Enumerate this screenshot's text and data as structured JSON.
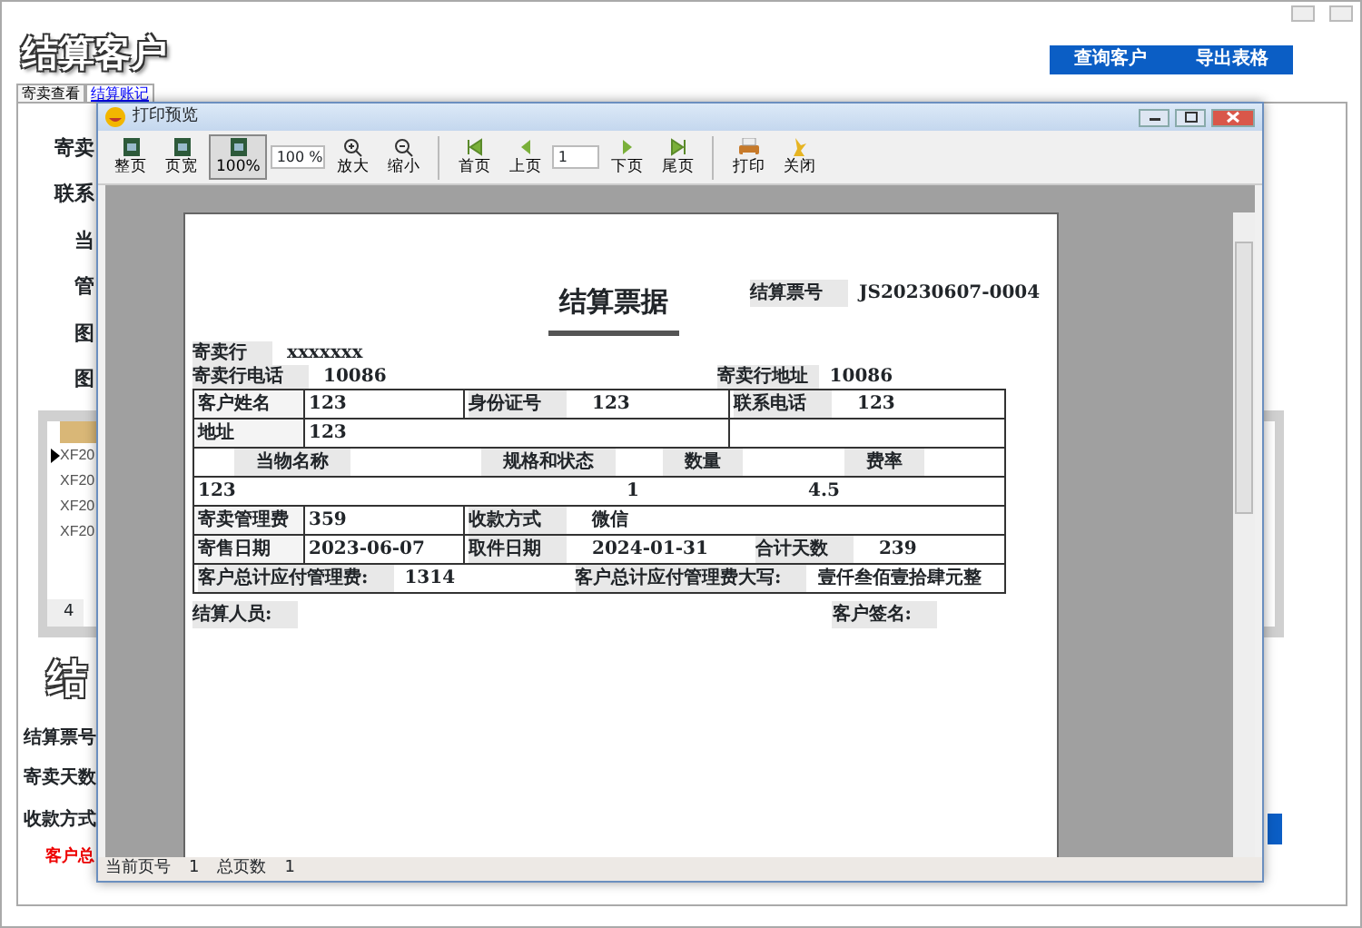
{
  "window": {
    "title": "结算客户",
    "buttons": [
      "查询客户",
      "导出表格"
    ]
  },
  "tabs": [
    {
      "label": "寄卖查看",
      "selected": false
    },
    {
      "label": "结算账记",
      "selected": true
    }
  ],
  "form_labels": [
    "寄卖",
    "联系",
    "当",
    "管",
    "图",
    "图"
  ],
  "grid": {
    "rows": [
      {
        "text": "XF20",
        "selected": true
      },
      {
        "text": "XF20",
        "selected": false
      },
      {
        "text": "XF20",
        "selected": false
      },
      {
        "text": "XF20",
        "selected": false
      }
    ],
    "footer": "4"
  },
  "summary": {
    "title": "结",
    "labels": [
      "结算票号",
      "寄卖天数",
      "收款方式"
    ],
    "total_label": "客户总"
  },
  "dialog": {
    "title": "打印预览",
    "toolbar": [
      {
        "kind": "page",
        "label": "整页",
        "selected": false
      },
      {
        "kind": "page",
        "label": "页宽",
        "selected": false
      },
      {
        "kind": "page",
        "label": "100%",
        "selected": true
      },
      {
        "kind": "field",
        "value": "100 %"
      },
      {
        "kind": "zoomin",
        "label": "放大",
        "selected": false
      },
      {
        "kind": "zoomout",
        "label": "缩小",
        "selected": false
      },
      {
        "kind": "separator"
      },
      {
        "kind": "first",
        "label": "首页",
        "selected": false
      },
      {
        "kind": "prev",
        "label": "上页",
        "selected": false
      },
      {
        "kind": "field",
        "value": "1"
      },
      {
        "kind": "next",
        "label": "下页",
        "selected": false
      },
      {
        "kind": "last",
        "label": "尾页",
        "selected": false
      },
      {
        "kind": "separator"
      },
      {
        "kind": "print",
        "label": "打印",
        "selected": false
      },
      {
        "kind": "exit",
        "label": "关闭",
        "selected": false
      }
    ],
    "status": [
      {
        "label": "当前页号",
        "value": "1"
      },
      {
        "label": "总页数",
        "value": "1"
      }
    ]
  },
  "report": {
    "title": "结算票据",
    "ticket_label": "结算票号",
    "ticket_no": "JS20230607-0004",
    "shop": {
      "name_label": "寄卖行",
      "name": "xxxxxxx",
      "phone_label": "寄卖行电话",
      "phone": "10086",
      "address_label": "寄卖行地址",
      "address": "10086"
    },
    "rows": [
      {
        "kind": "pairs",
        "cells": [
          [
            {
              "kind": "label",
              "text": "客户姓名"
            }
          ],
          [
            {
              "kind": "value",
              "text": "123"
            }
          ],
          [
            {
              "kind": "label",
              "text": "身份证号"
            },
            {
              "kind": "value",
              "text": "123"
            }
          ],
          [
            {
              "kind": "label",
              "text": "联系电话"
            },
            {
              "kind": "value",
              "text": "123"
            }
          ]
        ]
      },
      {
        "kind": "wide_mid",
        "cells": [
          [
            {
              "kind": "label",
              "text": "地址"
            }
          ],
          [
            {
              "kind": "value",
              "text": "123"
            }
          ],
          []
        ]
      },
      {
        "kind": "columns",
        "cells": [
          [
            {
              "kind": "header",
              "text": "当物名称"
            },
            {
              "kind": "header",
              "text": "规格和状态"
            },
            {
              "kind": "header",
              "text": "数量"
            },
            {
              "kind": "header",
              "text": "费率"
            }
          ]
        ]
      },
      {
        "kind": "columns",
        "cells": [
          [
            {
              "kind": "value",
              "text": "123"
            },
            {
              "kind": "blank"
            },
            {
              "kind": "value",
              "text": "1"
            },
            {
              "kind": "value",
              "text": "4.5"
            }
          ]
        ]
      },
      {
        "kind": "wide_last",
        "cells": [
          [
            {
              "kind": "label",
              "text": "寄卖管理费"
            }
          ],
          [
            {
              "kind": "value",
              "text": "359"
            }
          ],
          [
            {
              "kind": "label",
              "text": "收款方式"
            },
            {
              "kind": "value",
              "text": "微信"
            }
          ]
        ]
      },
      {
        "kind": "wide_last",
        "cells": [
          [
            {
              "kind": "label",
              "text": "寄售日期"
            }
          ],
          [
            {
              "kind": "value",
              "text": "2023-06-07"
            }
          ],
          [
            {
              "kind": "label",
              "text": "取件日期"
            },
            {
              "kind": "value",
              "text": "2024-01-31"
            },
            {
              "kind": "label",
              "text": "合计天数"
            },
            {
              "kind": "value",
              "text": "239"
            }
          ]
        ]
      },
      {
        "kind": "full",
        "cells": [
          [
            {
              "kind": "label",
              "text": "客户总计应付管理费:"
            },
            {
              "kind": "value",
              "text": "1314"
            },
            {
              "kind": "label",
              "text": "客户总计应付管理费大写:"
            },
            {
              "kind": "value",
              "text": "壹仟叁佰壹拾肆元整"
            }
          ]
        ]
      }
    ],
    "footer": [
      {
        "text": "结算人员:"
      },
      {
        "text": "客户签名:"
      }
    ]
  }
}
